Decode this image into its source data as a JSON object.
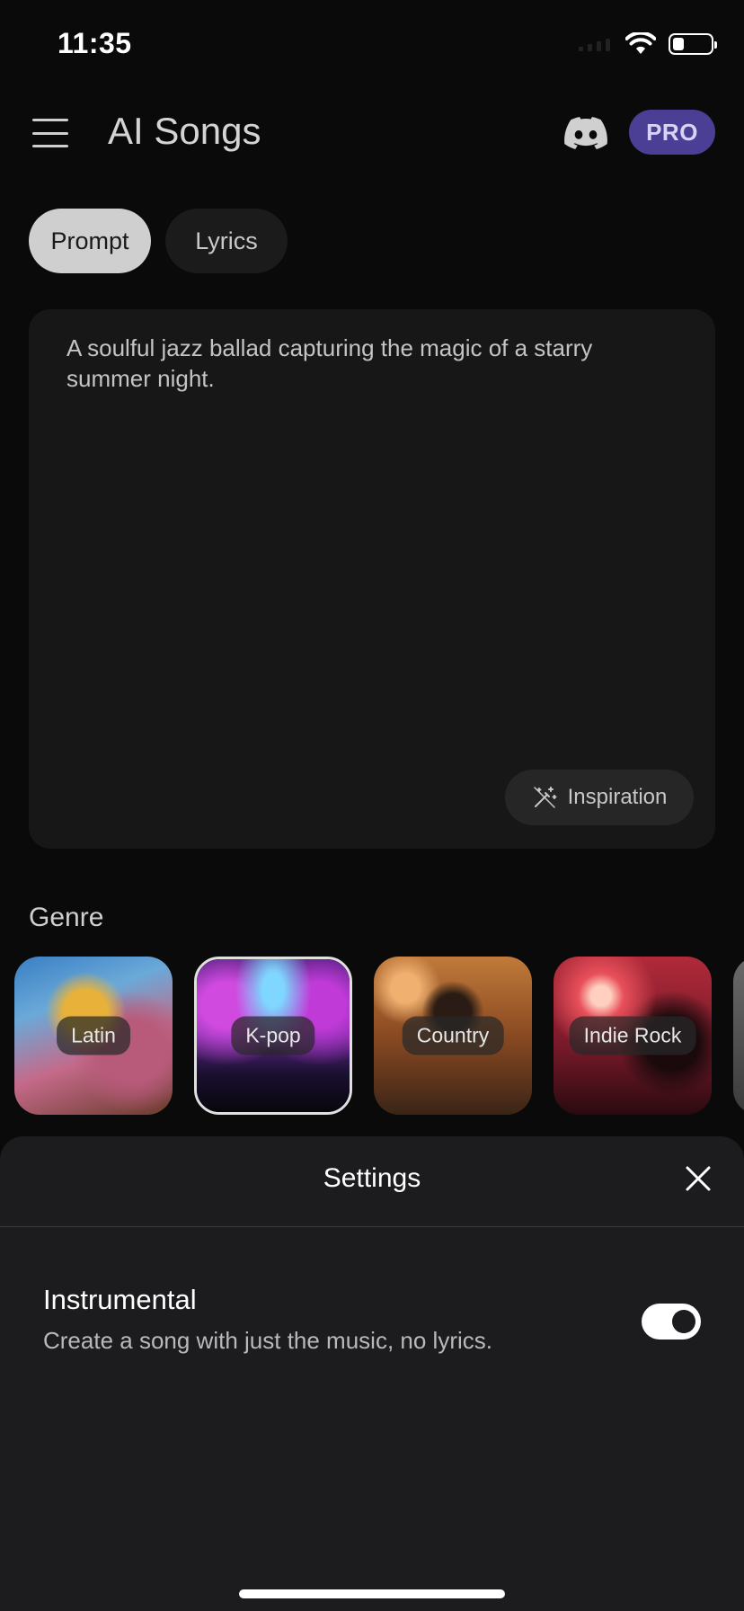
{
  "status_bar": {
    "time": "11:35",
    "battery_level": 0.3
  },
  "header": {
    "title": "AI Songs",
    "pro_label": "PRO"
  },
  "tabs": [
    {
      "label": "Prompt",
      "active": true
    },
    {
      "label": "Lyrics",
      "active": false
    }
  ],
  "prompt": {
    "text": "A soulful jazz ballad capturing the magic of a starry summer night.",
    "inspiration_label": "Inspiration"
  },
  "genre": {
    "heading": "Genre",
    "items": [
      {
        "label": "Latin",
        "selected": false
      },
      {
        "label": "K-pop",
        "selected": true
      },
      {
        "label": "Country",
        "selected": false
      },
      {
        "label": "Indie Rock",
        "selected": false
      }
    ]
  },
  "settings": {
    "title": "Settings",
    "instrumental_title": "Instrumental",
    "instrumental_desc": "Create a song with just the music, no lyrics.",
    "instrumental_on": true
  },
  "colors": {
    "background": "#0a0a0a",
    "pro_badge": "#4a3f95",
    "sheet": "#1c1c1e"
  }
}
